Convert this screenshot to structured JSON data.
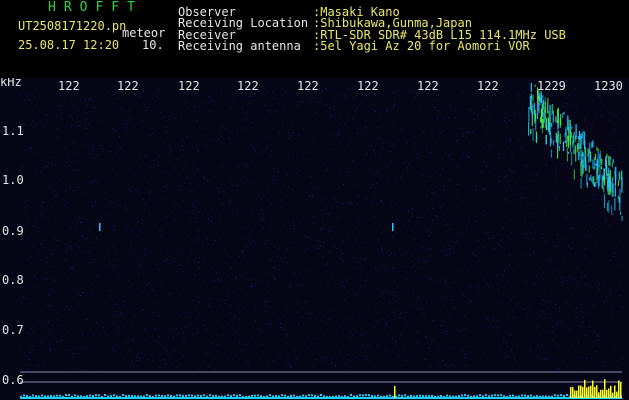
{
  "header": {
    "logo": "HROFFT",
    "filename": "UT2508171220.pn",
    "meteor_label": "meteor",
    "datetime": "25.08.17 12:20",
    "count": "10.",
    "info": [
      {
        "label": "Observer",
        "value": ":Masaki Kano"
      },
      {
        "label": "Receiving Location",
        "value": ":Shibukawa,Gunma,Japan"
      },
      {
        "label": "Receiver",
        "value": ":RTL-SDR SDR# 43dB L15 114.1MHz USB"
      },
      {
        "label": "Receiving antenna",
        "value": ":5el Yagi Az 20 for Aomori VOR"
      }
    ]
  },
  "plot": {
    "y_unit": "kHz",
    "y_ticks": [
      "1.1",
      "1.0",
      "0.9",
      "0.8",
      "0.7",
      "0.6"
    ],
    "x_ticks": [
      "122",
      "122",
      "122",
      "122",
      "122",
      "122",
      "122",
      "122",
      "1229",
      "1230"
    ],
    "colors": {
      "background": "#060616",
      "noise": "#1c1c6e",
      "signal": "#22c8ff",
      "strong": "#4af04a",
      "baseline": "#19d0ff",
      "peak": "#ffff20"
    }
  }
}
